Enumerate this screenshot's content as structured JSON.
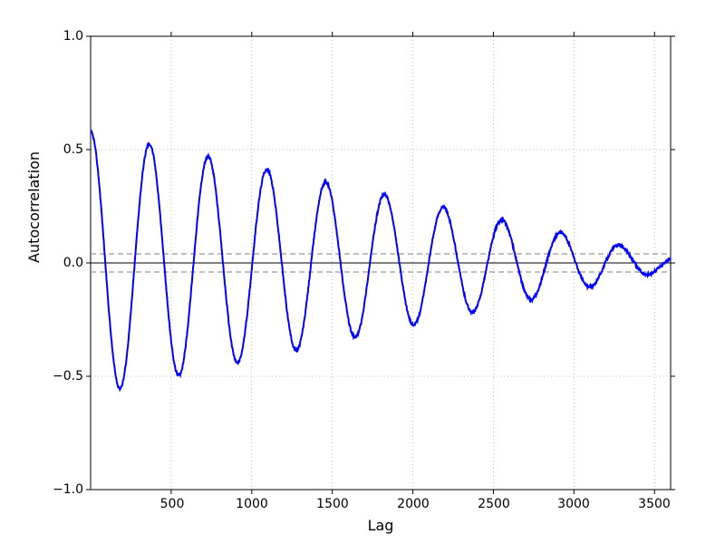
{
  "chart_data": {
    "type": "line",
    "title": "",
    "xlabel": "Lag",
    "ylabel": "Autocorrelation",
    "xlim": [
      0,
      3600
    ],
    "ylim": [
      -1.0,
      1.0
    ],
    "x_ticks": [
      500,
      1000,
      1500,
      2000,
      2500,
      3000,
      3500
    ],
    "y_ticks": [
      -1.0,
      -0.5,
      0.0,
      0.5,
      1.0
    ],
    "grid": true,
    "conf_band": {
      "upper": 0.04,
      "lower": -0.04
    },
    "period": 365,
    "model": "damped cosine, amplitude decays roughly linearly from ~0.57 at lag 0 to ~0.06 at lag 3500",
    "peaks": [
      {
        "lag": 0,
        "acf": 0.58
      },
      {
        "lag": 180,
        "acf": -0.49
      },
      {
        "lag": 365,
        "acf": 0.49
      },
      {
        "lag": 545,
        "acf": -0.43
      },
      {
        "lag": 730,
        "acf": 0.41
      },
      {
        "lag": 910,
        "acf": -0.36
      },
      {
        "lag": 1095,
        "acf": 0.36
      },
      {
        "lag": 1280,
        "acf": -0.31
      },
      {
        "lag": 1460,
        "acf": 0.31
      },
      {
        "lag": 1640,
        "acf": -0.28
      },
      {
        "lag": 1825,
        "acf": 0.27
      },
      {
        "lag": 2010,
        "acf": -0.23
      },
      {
        "lag": 2190,
        "acf": 0.22
      },
      {
        "lag": 2370,
        "acf": -0.2
      },
      {
        "lag": 2555,
        "acf": 0.19
      },
      {
        "lag": 2740,
        "acf": -0.15
      },
      {
        "lag": 2920,
        "acf": 0.14
      },
      {
        "lag": 3100,
        "acf": -0.08
      },
      {
        "lag": 3285,
        "acf": 0.06
      },
      {
        "lag": 3470,
        "acf": -0.05
      }
    ]
  },
  "labels": {
    "x_500": "500",
    "x_1000": "1000",
    "x_1500": "1500",
    "x_2000": "2000",
    "x_2500": "2500",
    "x_3000": "3000",
    "x_3500": "3500",
    "y_n10": "−1.0",
    "y_n05": "−1.0",
    "y_n05b": "−0.5",
    "y_00": "0.0",
    "y_05": "0.5",
    "y_10": "1.0"
  }
}
